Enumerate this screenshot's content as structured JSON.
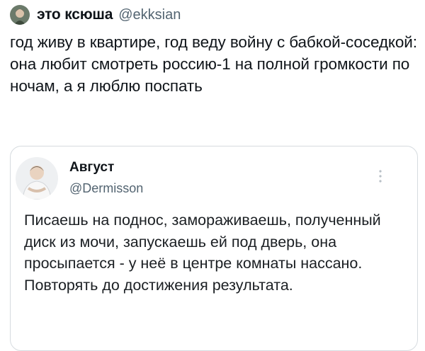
{
  "tweet": {
    "author_name": "это ксюша",
    "author_handle": "@ekksian",
    "avatar_icon": "user-avatar-icon",
    "text": "год живу в квартире, год веду войну с бабкой-соседкой: она любит смотреть россию-1 на полной громкости по ночам, а я люблю поспать"
  },
  "quoted_tweet": {
    "author_name": "Август",
    "author_handle": "@Dermisson",
    "avatar_icon": "user-avatar-icon",
    "menu_icon": "more-options-icon",
    "text": "Писаешь на поднос, замораживаешь, полученный диск из мочи, запускаешь ей под дверь, она просыпается - у неё в центре комнаты нассано. Повторять до достижения результата."
  }
}
